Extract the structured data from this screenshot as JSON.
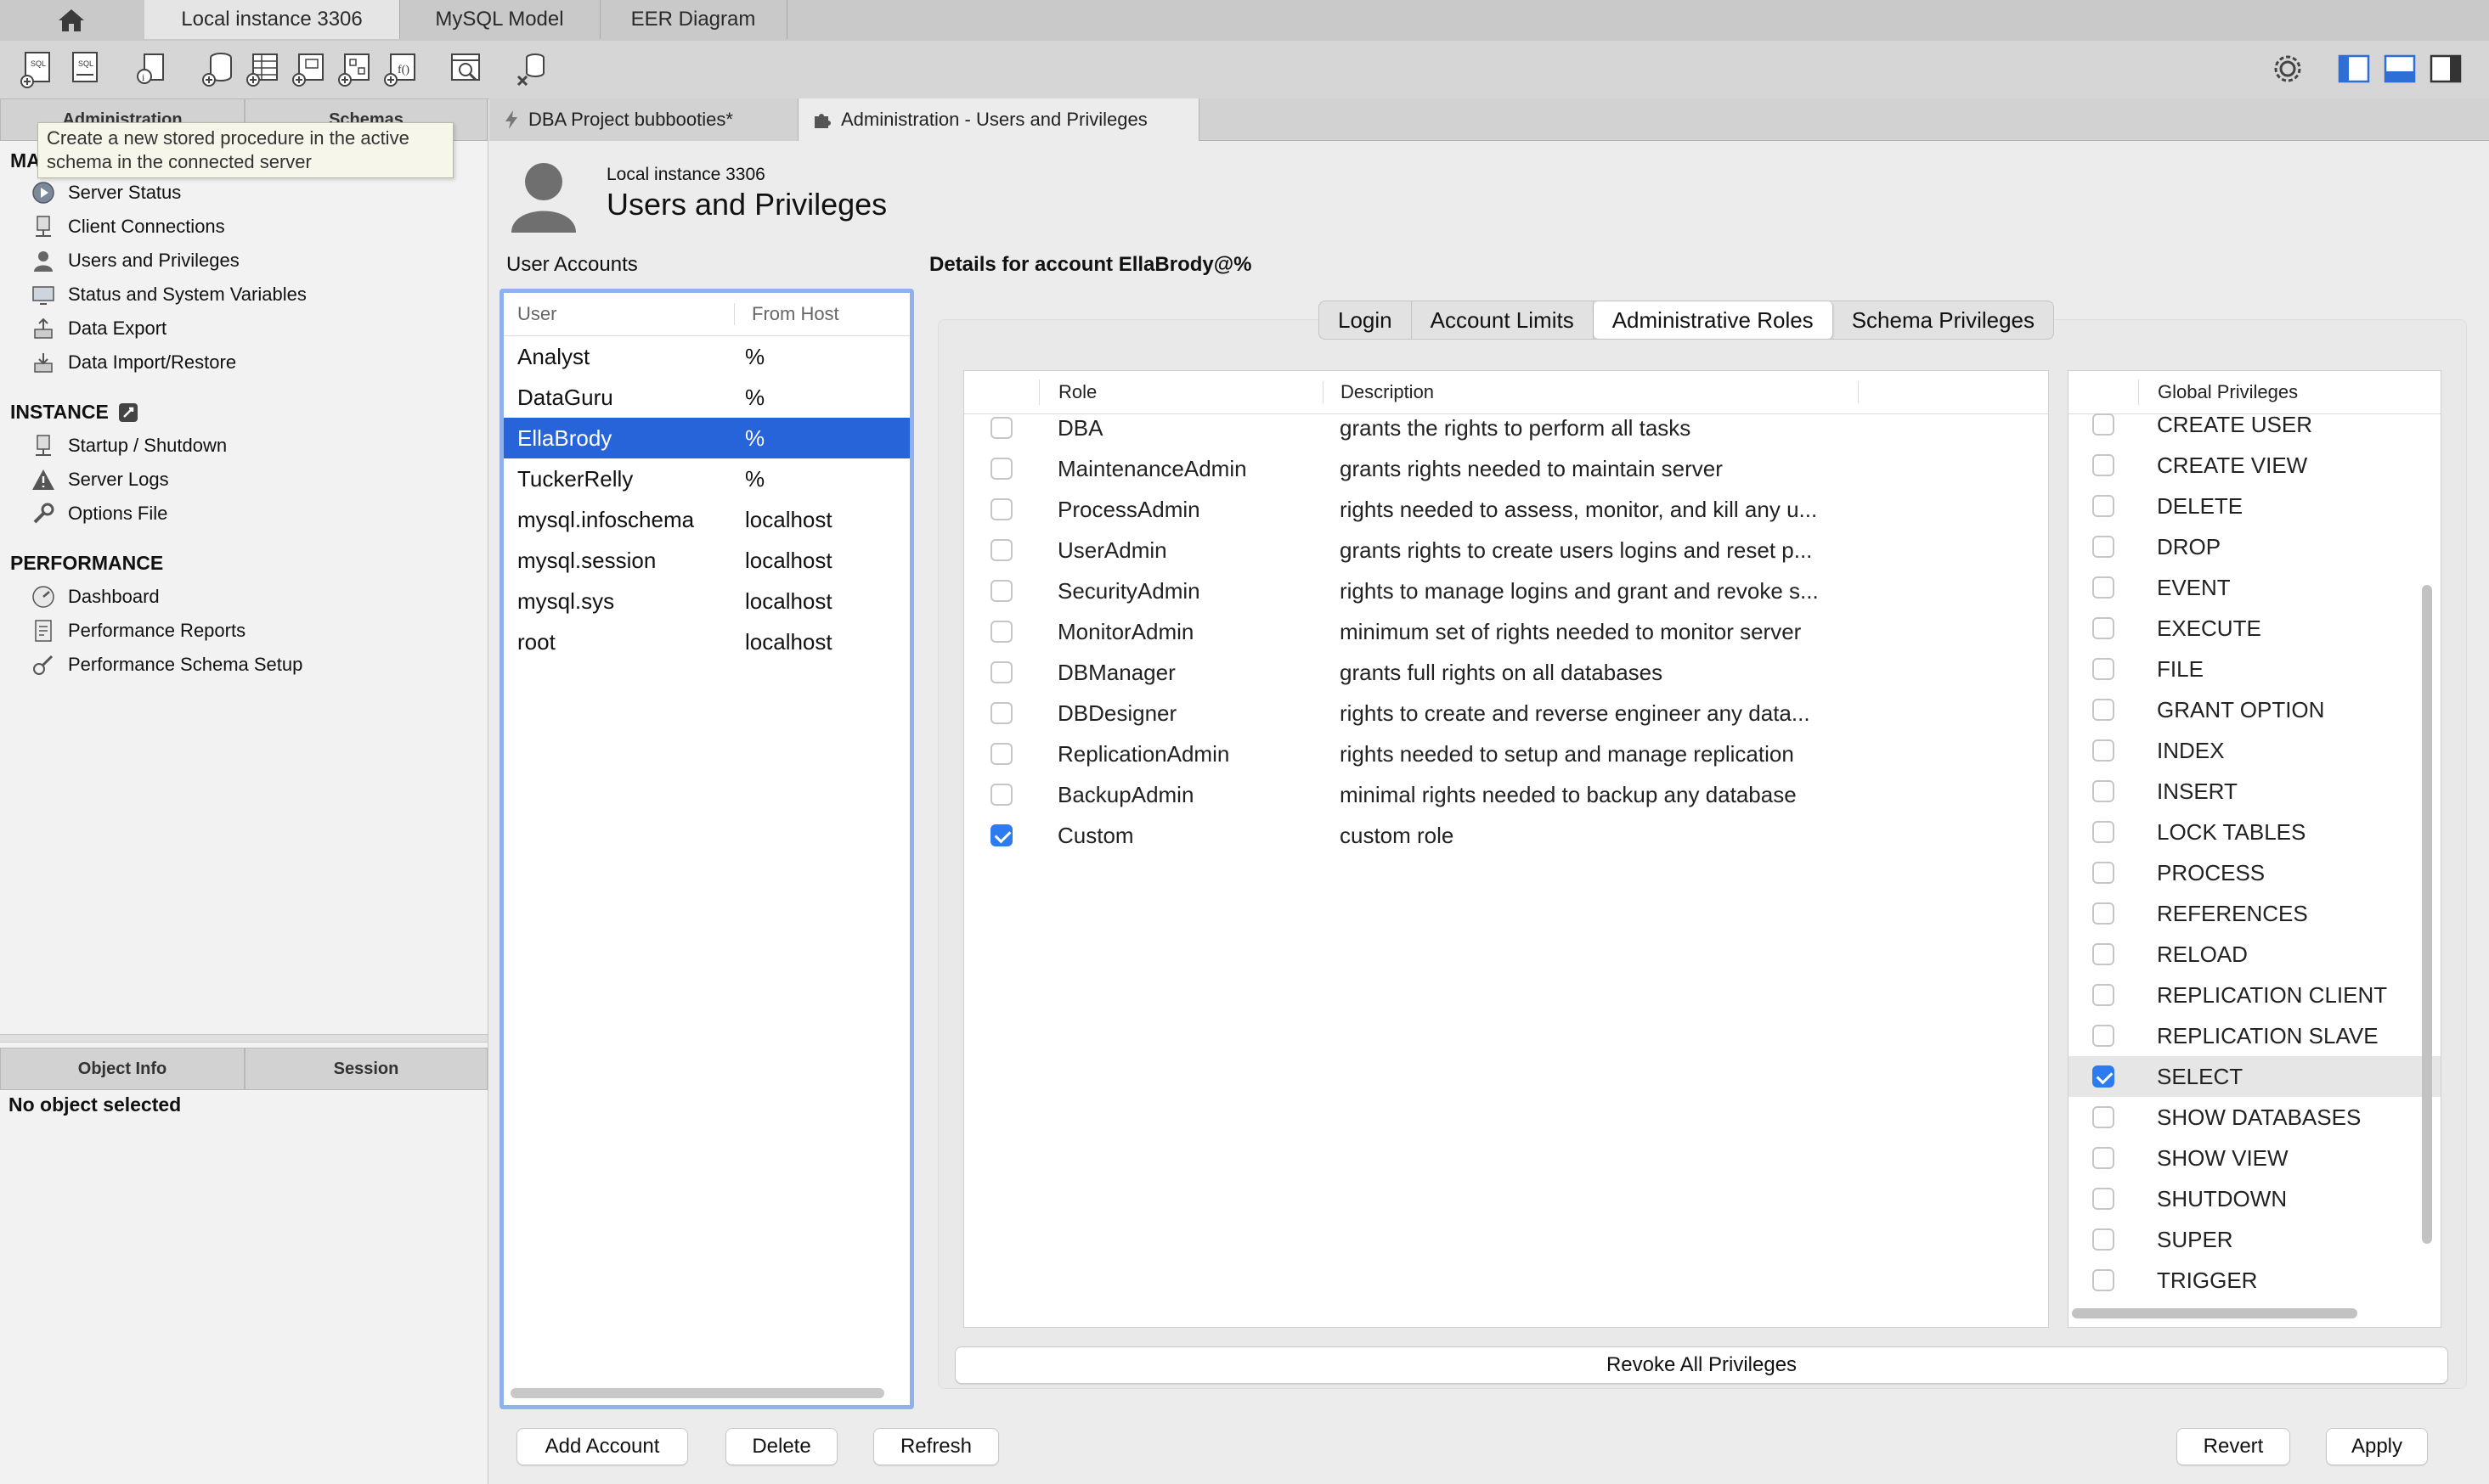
{
  "top_tabs": [
    "Local instance 3306",
    "MySQL Model",
    "EER Diagram"
  ],
  "sidebar": {
    "tabs": [
      "Administration",
      "Schemas"
    ],
    "tooltip": "Create a new stored procedure in the active schema in the connected server",
    "management_header_partial": "MA",
    "management": [
      "Server Status",
      "Client Connections",
      "Users and Privileges",
      "Status and System Variables",
      "Data Export",
      "Data Import/Restore"
    ],
    "instance_header": "INSTANCE",
    "instance": [
      "Startup / Shutdown",
      "Server Logs",
      "Options File"
    ],
    "performance_header": "PERFORMANCE",
    "performance": [
      "Dashboard",
      "Performance Reports",
      "Performance Schema Setup"
    ],
    "bottom_tabs": [
      "Object Info",
      "Session"
    ],
    "no_object": "No object selected"
  },
  "doc_tabs": [
    "DBA Project bubbooties*",
    "Administration - Users and Privileges"
  ],
  "header": {
    "instance": "Local instance 3306",
    "title": "Users and Privileges"
  },
  "accounts": {
    "label": "User Accounts",
    "col_user": "User",
    "col_host": "From Host",
    "rows": [
      {
        "user": "Analyst",
        "host": "%"
      },
      {
        "user": "DataGuru",
        "host": "%"
      },
      {
        "user": "EllaBrody",
        "host": "%"
      },
      {
        "user": "TuckerRelly",
        "host": "%"
      },
      {
        "user": "mysql.infoschema",
        "host": "localhost"
      },
      {
        "user": "mysql.session",
        "host": "localhost"
      },
      {
        "user": "mysql.sys",
        "host": "localhost"
      },
      {
        "user": "root",
        "host": "localhost"
      }
    ],
    "selected": "EllaBrody"
  },
  "details": {
    "title": "Details for account EllaBrody@%",
    "tabs": [
      "Login",
      "Account Limits",
      "Administrative Roles",
      "Schema Privileges"
    ],
    "active_tab": "Administrative Roles",
    "roles_col_role": "Role",
    "roles_col_desc": "Description",
    "roles": [
      {
        "role": "DBA",
        "desc": "grants the rights to perform all tasks",
        "checked": false
      },
      {
        "role": "MaintenanceAdmin",
        "desc": "grants rights needed to maintain server",
        "checked": false
      },
      {
        "role": "ProcessAdmin",
        "desc": "rights needed to assess, monitor, and kill any u...",
        "checked": false
      },
      {
        "role": "UserAdmin",
        "desc": "grants rights to create users logins and reset p...",
        "checked": false
      },
      {
        "role": "SecurityAdmin",
        "desc": "rights to manage logins and grant and revoke s...",
        "checked": false
      },
      {
        "role": "MonitorAdmin",
        "desc": "minimum set of rights needed to monitor server",
        "checked": false
      },
      {
        "role": "DBManager",
        "desc": "grants full rights on all databases",
        "checked": false
      },
      {
        "role": "DBDesigner",
        "desc": "rights to create and reverse engineer any data...",
        "checked": false
      },
      {
        "role": "ReplicationAdmin",
        "desc": "rights needed to setup and manage replication",
        "checked": false
      },
      {
        "role": "BackupAdmin",
        "desc": "minimal rights needed to backup any database",
        "checked": false
      },
      {
        "role": "Custom",
        "desc": "custom role",
        "checked": true
      }
    ],
    "priv_col": "Global Privileges",
    "privileges": [
      {
        "name": "CREATE USER",
        "checked": false
      },
      {
        "name": "CREATE VIEW",
        "checked": false
      },
      {
        "name": "DELETE",
        "checked": false
      },
      {
        "name": "DROP",
        "checked": false
      },
      {
        "name": "EVENT",
        "checked": false
      },
      {
        "name": "EXECUTE",
        "checked": false
      },
      {
        "name": "FILE",
        "checked": false
      },
      {
        "name": "GRANT OPTION",
        "checked": false
      },
      {
        "name": "INDEX",
        "checked": false
      },
      {
        "name": "INSERT",
        "checked": false
      },
      {
        "name": "LOCK TABLES",
        "checked": false
      },
      {
        "name": "PROCESS",
        "checked": false
      },
      {
        "name": "REFERENCES",
        "checked": false
      },
      {
        "name": "RELOAD",
        "checked": false
      },
      {
        "name": "REPLICATION CLIENT",
        "checked": false
      },
      {
        "name": "REPLICATION SLAVE",
        "checked": false
      },
      {
        "name": "SELECT",
        "checked": true
      },
      {
        "name": "SHOW DATABASES",
        "checked": false
      },
      {
        "name": "SHOW VIEW",
        "checked": false
      },
      {
        "name": "SHUTDOWN",
        "checked": false
      },
      {
        "name": "SUPER",
        "checked": false
      },
      {
        "name": "TRIGGER",
        "checked": false
      }
    ],
    "revoke_label": "Revoke All Privileges"
  },
  "buttons": {
    "add": "Add Account",
    "delete": "Delete",
    "refresh": "Refresh",
    "revert": "Revert",
    "apply": "Apply"
  },
  "colors": {
    "accent": "#2764d9",
    "checkbox": "#2d7bf0",
    "list_focus": "#8fb2ec"
  }
}
